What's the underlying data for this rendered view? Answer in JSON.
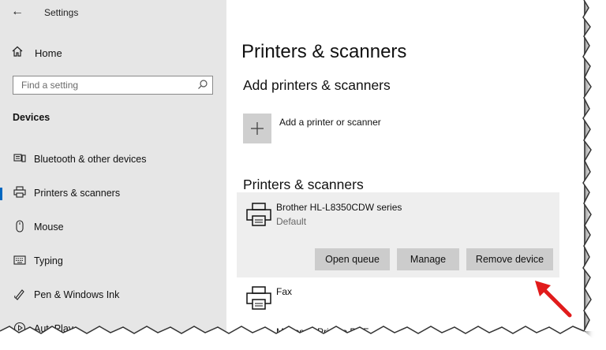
{
  "app": {
    "title": "Settings",
    "back_glyph": "←"
  },
  "sidebar": {
    "home_label": "Home",
    "search_placeholder": "Find a setting",
    "section_label": "Devices",
    "items": [
      {
        "label": "Bluetooth & other devices",
        "icon": "bluetooth-devices-icon",
        "active": false
      },
      {
        "label": "Printers & scanners",
        "icon": "printer-icon",
        "active": true
      },
      {
        "label": "Mouse",
        "icon": "mouse-icon",
        "active": false
      },
      {
        "label": "Typing",
        "icon": "keyboard-icon",
        "active": false
      },
      {
        "label": "Pen & Windows Ink",
        "icon": "pen-icon",
        "active": false
      },
      {
        "label": "AutoPlay",
        "icon": "autoplay-icon",
        "active": false
      }
    ]
  },
  "main": {
    "page_title": "Printers & scanners",
    "add_section_title": "Add printers & scanners",
    "add_label": "Add a printer or scanner",
    "list_section_title": "Printers & scanners",
    "printers": [
      {
        "name": "Brother HL-L8350CDW series",
        "status": "Default"
      },
      {
        "name": "Fax",
        "status": ""
      }
    ],
    "buttons": {
      "open_queue": "Open queue",
      "manage": "Manage",
      "remove": "Remove device"
    },
    "partial_text": "Microsoft Print to PDF"
  },
  "colors": {
    "sidebar_bg": "#e6e6e6",
    "accent": "#0067c0",
    "button_bg": "#cccccc",
    "card_bg": "#eeeeee",
    "arrow": "#e11b1b"
  }
}
